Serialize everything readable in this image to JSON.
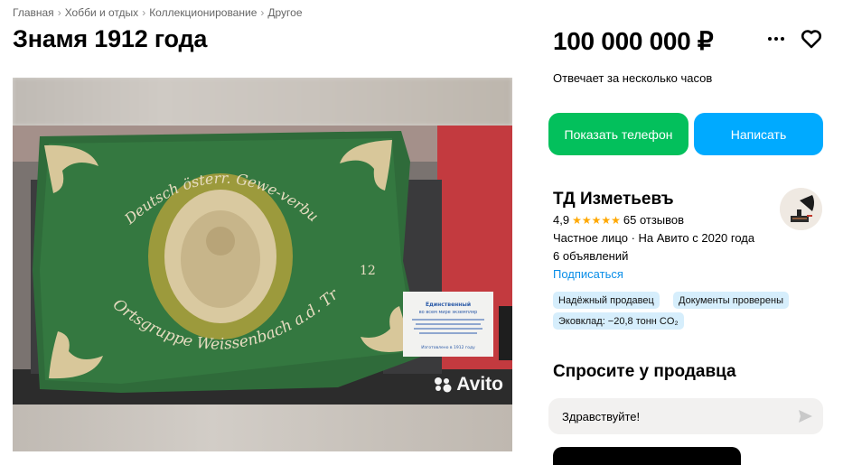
{
  "breadcrumb": [
    "Главная",
    "Хобби и отдых",
    "Коллекционирование",
    "Другое"
  ],
  "breadcrumb_separator": "›",
  "title": "Знамя 1912 года",
  "gallery": {
    "watermark": "Avito",
    "banner_text": {
      "line1": "Deutsch österr. Gewe-verbund",
      "line2": "Ortsgruppe Weissenbach a.d. Triesting",
      "year": "12"
    },
    "card_text": {
      "title1": "Единственный",
      "title2": "во всем мире экземпляр",
      "footer": "Изготовлено в 1912 году"
    }
  },
  "price": "100 000 000 ₽",
  "reply_time": "Отвечает за несколько часов",
  "buttons": {
    "show_phone": "Показать телефон",
    "write": "Написать"
  },
  "seller": {
    "name": "ТД Изметьевъ",
    "rating": "4,9",
    "stars": "★★★★★",
    "reviews": "65 отзывов",
    "type": "Частное лицо · На Авито с 2020 года",
    "ads_count": "6 объявлений",
    "subscribe": "Подписаться"
  },
  "badges": [
    "Надёжный продавец",
    "Документы проверены",
    "Эковклад: −20,8 тонн CO₂"
  ],
  "ask": {
    "title": "Спросите у продавца",
    "message": "Здравствуйте!"
  },
  "colors": {
    "green_button": "#03c05c",
    "blue_button": "#00aaff",
    "star": "#ffa800",
    "link": "#0a8ee8",
    "badge": "#d6eefc",
    "banner_green": "#2f6b3a"
  },
  "icons": [
    "more-icon",
    "heart-icon",
    "avito-logo-icon",
    "send-icon"
  ]
}
